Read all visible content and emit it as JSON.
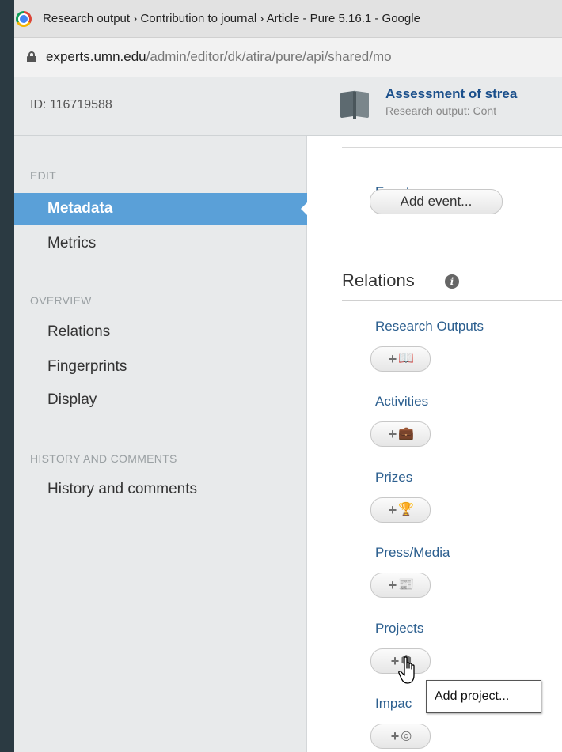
{
  "browser": {
    "tab_title": "Research output › Contribution to journal › Article - Pure 5.16.1 - Google",
    "url_host": "experts.umn.edu",
    "url_path": "/admin/editor/dk/atira/pure/api/shared/mo"
  },
  "header": {
    "record_id": "ID: 116719588",
    "title": "Assessment of strea",
    "subtitle": "Research output: Cont"
  },
  "sidebar": {
    "sections": [
      {
        "label": "EDIT",
        "items": [
          {
            "label": "Metadata",
            "active": true
          },
          {
            "label": "Metrics"
          }
        ]
      },
      {
        "label": "OVERVIEW",
        "items": [
          {
            "label": "Relations"
          },
          {
            "label": "Fingerprints"
          },
          {
            "label": "Display"
          }
        ]
      },
      {
        "label": "HISTORY AND COMMENTS",
        "items": [
          {
            "label": "History and comments"
          }
        ]
      }
    ]
  },
  "main": {
    "event": {
      "label": "Event",
      "button": "Add event..."
    },
    "relations": {
      "title": "Relations",
      "info_icon": "info-icon",
      "groups": [
        {
          "label": "Research Outputs",
          "button_icon": "book-icon",
          "glyph": "📖"
        },
        {
          "label": "Activities",
          "button_icon": "briefcase-icon",
          "glyph": "💼"
        },
        {
          "label": "Prizes",
          "button_icon": "trophy-icon",
          "glyph": "🏆"
        },
        {
          "label": "Press/Media",
          "button_icon": "newspaper-icon",
          "glyph": "📰"
        },
        {
          "label": "Projects",
          "button_icon": "cube-icon",
          "glyph": "⬢"
        },
        {
          "label": "Impac",
          "button_icon": "target-icon",
          "glyph": "◎"
        }
      ],
      "plus": "+"
    }
  },
  "tooltip": {
    "text": "Add project..."
  },
  "colors": {
    "accent": "#5aa0d8",
    "link": "#2c5f8f",
    "title": "#1a4f8b"
  }
}
